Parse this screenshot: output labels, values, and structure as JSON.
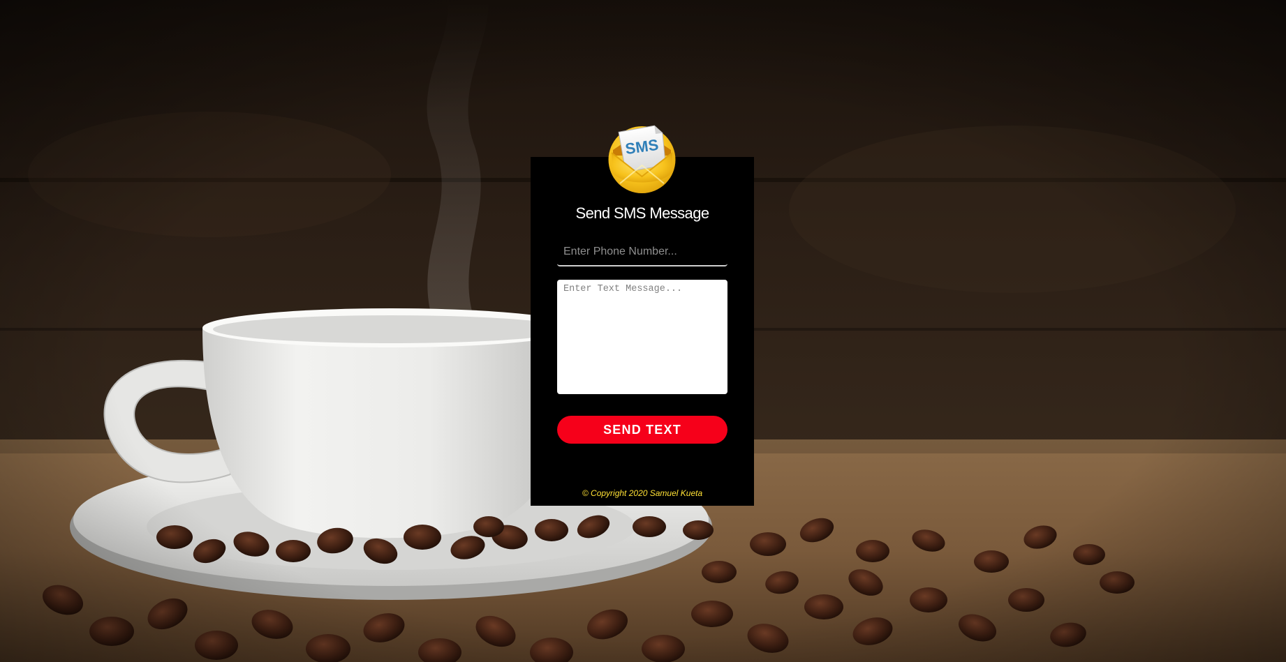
{
  "background": {
    "scene": "coffee cup on saucer with coffee beans on burlap"
  },
  "form": {
    "logo_text": "SMS",
    "title": "Send SMS Message",
    "phone_placeholder": "Enter Phone Number...",
    "message_placeholder": "Enter Text Message...",
    "send_label": "SEND TEXT",
    "copyright": "© Copyright 2020 Samuel Kueta"
  },
  "colors": {
    "card_background": "#000000",
    "send_button": "#f6001a",
    "copyright_text": "#ffe135",
    "logo_envelope": "#f7c21c"
  }
}
